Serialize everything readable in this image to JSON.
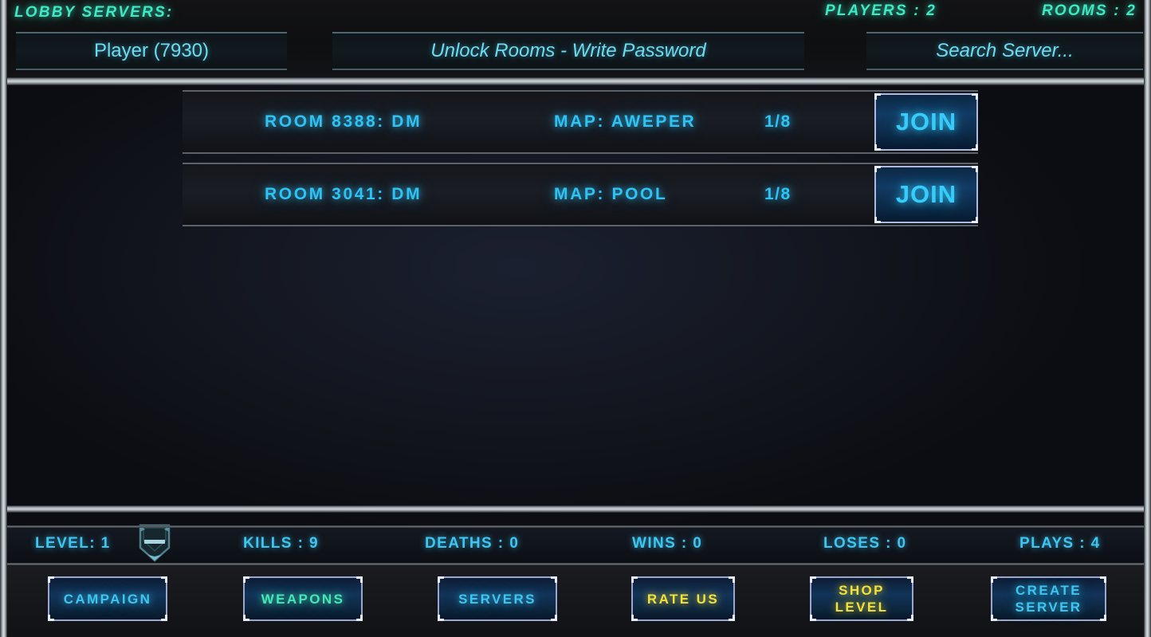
{
  "header": {
    "title": "LOBBY SERVERS:",
    "players_label": "PLAYERS : 2",
    "rooms_label": "ROOMS : 2",
    "player_field_value": "Player (7930)",
    "password_field_placeholder": "Unlock Rooms - Write Password",
    "search_field_placeholder": "Search  Server..."
  },
  "server_list": {
    "rows": [
      {
        "room": "ROOM 8388: DM",
        "map": "MAP: AWEPER",
        "slots": "1/8",
        "join_label": "JOIN"
      },
      {
        "room": "ROOM 3041: DM",
        "map": "MAP: POOL",
        "slots": "1/8",
        "join_label": "JOIN"
      }
    ]
  },
  "stats": {
    "items": [
      {
        "label": "LEVEL: 1"
      },
      {
        "label": "KILLS : 9"
      },
      {
        "label": "DEATHS : 0"
      },
      {
        "label": "WINS : 0"
      },
      {
        "label": "LOSES : 0"
      },
      {
        "label": "PLAYS : 4"
      }
    ],
    "level_badge_icon": "shield-rank-icon"
  },
  "bottom_buttons": [
    {
      "label": "CAMPAIGN",
      "color": "#3ec6f2"
    },
    {
      "label": "WEAPONS",
      "color": "#45e8b4"
    },
    {
      "label": "SERVERS",
      "color": "#3ec6f2"
    },
    {
      "label": "RATE US",
      "color": "#f2e23c"
    },
    {
      "label": "SHOP\nLEVEL",
      "color": "#f2e23c"
    },
    {
      "label": "CREATE\nSERVER",
      "color": "#3ec6f2"
    }
  ],
  "theme": {
    "accent_cyan": "#3ec6f2",
    "accent_teal": "#3ee9c4",
    "accent_gold": "#f2e23c",
    "frame_silver": "#cfd6db",
    "background": "#0c0d12"
  }
}
